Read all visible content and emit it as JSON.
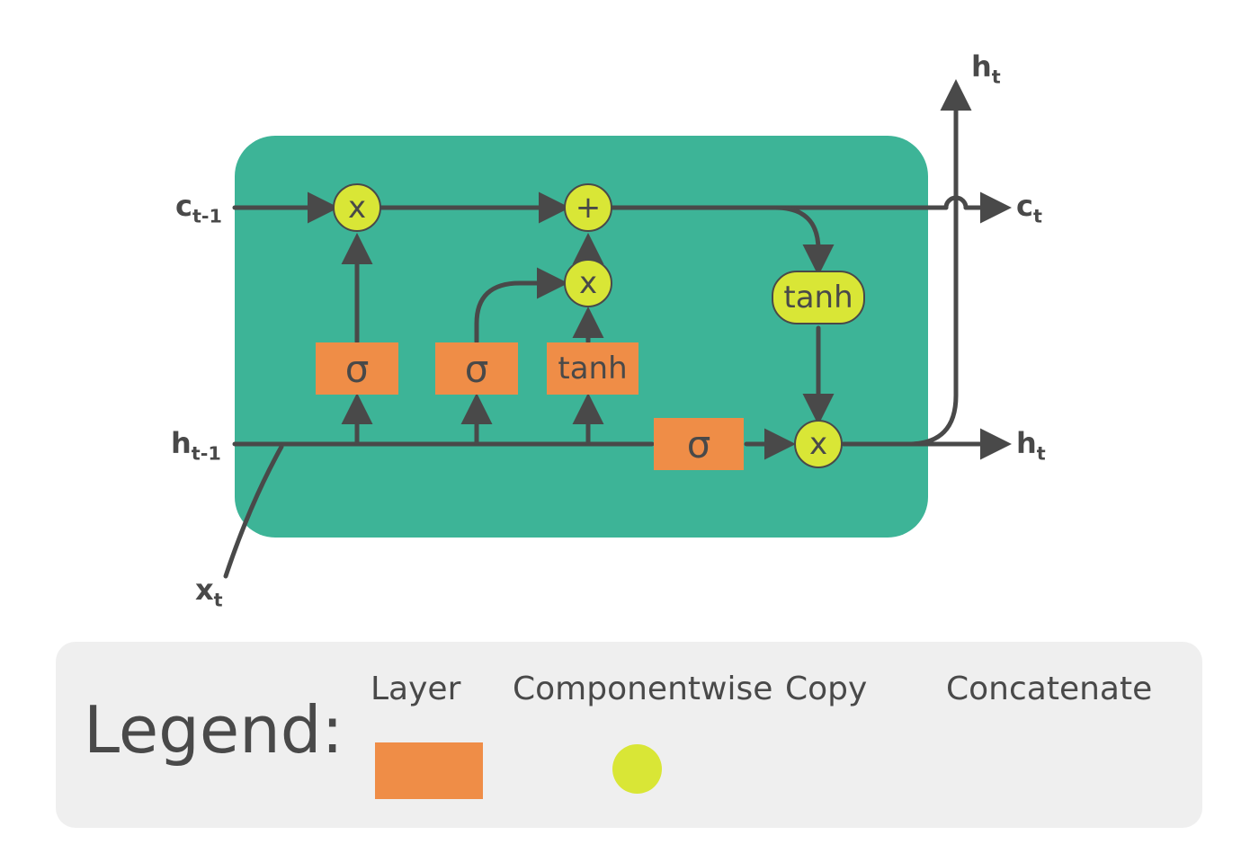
{
  "inputs": {
    "c_prev": "c",
    "c_prev_sub": "t-1",
    "h_prev": "h",
    "h_prev_sub": "t-1",
    "x_t": "x",
    "x_t_sub": "t"
  },
  "outputs": {
    "c_t": "c",
    "c_t_sub": "t",
    "h_t": "h",
    "h_t_sub": "t",
    "h_t_top": "h",
    "h_t_top_sub": "t"
  },
  "gates": {
    "forget": "σ",
    "input": "σ",
    "candidate": "tanh",
    "output": "σ",
    "cell_tanh": "tanh"
  },
  "ops": {
    "mul1": "x",
    "plus": "+",
    "mul2": "x",
    "mul3": "x"
  },
  "legend": {
    "title": "Legend:",
    "layer": "Layer",
    "componentwise": "Componentwise",
    "copy": "Copy",
    "concatenate": "Concatenate"
  },
  "colors": {
    "cell": "#3db497",
    "layer": "#ef8d47",
    "op": "#d9e636",
    "stroke": "#494949",
    "legend_bg": "#efefef"
  }
}
